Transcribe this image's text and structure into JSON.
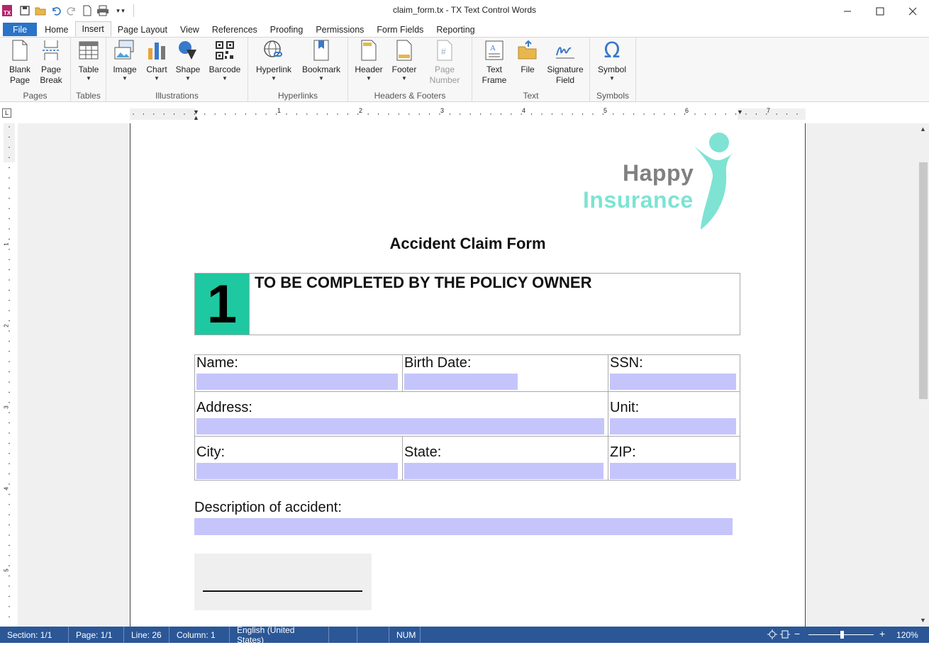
{
  "window": {
    "title": "claim_form.tx - TX Text Control Words",
    "minimize_icon": "minimize-icon",
    "maximize_icon": "maximize-icon",
    "close_icon": "close-icon"
  },
  "quick_access": {
    "icons": [
      "app-icon",
      "save-icon",
      "open-icon",
      "undo-icon",
      "redo-icon",
      "new-icon",
      "print-icon",
      "dropdown-icon"
    ]
  },
  "tabs": [
    "File",
    "Home",
    "Insert",
    "Page Layout",
    "View",
    "References",
    "Proofing",
    "Permissions",
    "Form Fields",
    "Reporting"
  ],
  "active_tab": "Insert",
  "ribbon": {
    "pages": {
      "label": "Pages",
      "blank_page": "Blank\nPage",
      "page_break": "Page\nBreak"
    },
    "tables": {
      "label": "Tables",
      "table": "Table"
    },
    "illustrations": {
      "label": "Illustrations",
      "image": "Image",
      "chart": "Chart",
      "shape": "Shape",
      "barcode": "Barcode"
    },
    "hyperlinks": {
      "label": "Hyperlinks",
      "hyperlink": "Hyperlink",
      "bookmark": "Bookmark"
    },
    "headers_footers": {
      "label": "Headers & Footers",
      "header": "Header",
      "footer": "Footer",
      "page_number": "Page\nNumber"
    },
    "text": {
      "label": "Text",
      "text_frame": "Text\nFrame",
      "file": "File",
      "signature_field": "Signature\nField"
    },
    "symbols": {
      "label": "Symbols",
      "symbol": "Symbol"
    }
  },
  "ruler": {
    "h_numbers": [
      "1",
      "2",
      "3",
      "4",
      "5",
      "6",
      "7"
    ],
    "v_numbers": [
      "1",
      "2",
      "3",
      "4",
      "5"
    ]
  },
  "document": {
    "logo_line1": "Happy",
    "logo_line2": "Insurance",
    "form_title": "Accident Claim Form",
    "section_number": "1",
    "section_title": "TO BE COMPLETED BY THE POLICY OWNER",
    "labels": {
      "name": "Name:",
      "birth_date": "Birth Date:",
      "ssn": "SSN:",
      "address": "Address:",
      "unit": "Unit:",
      "city": "City:",
      "state": "State:",
      "zip": "ZIP:",
      "description": "Description of accident:"
    }
  },
  "status": {
    "section": "Section: 1/1",
    "page": "Page: 1/1",
    "line": "Line: 26",
    "column": "Column: 1",
    "language": "English (United States)",
    "num": "NUM",
    "zoom": "120%"
  },
  "colors": {
    "accent_blue": "#2b73c7",
    "status_bar": "#2b5797",
    "form_field": "#c5c5fc",
    "section_green": "#1ec8a0",
    "logo_gray": "#808080",
    "logo_teal": "#7ee3d3"
  }
}
